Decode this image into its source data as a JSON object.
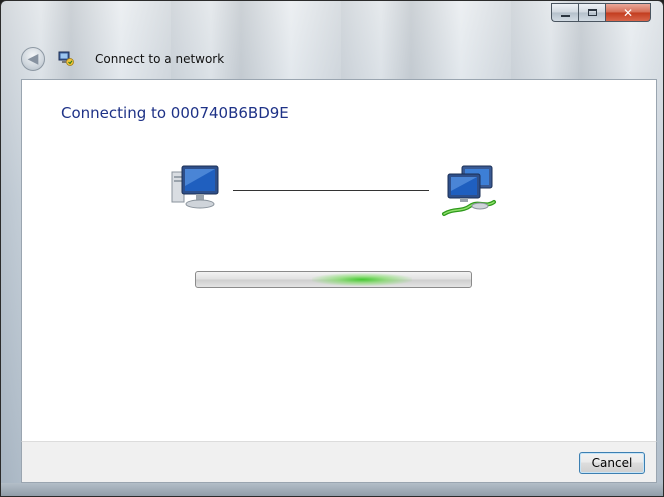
{
  "window": {
    "title": "Connect to a network",
    "caption": {
      "minimize_icon": "minimize-icon",
      "maximize_icon": "maximize-icon",
      "close_glyph": "✕"
    }
  },
  "nav": {
    "back_glyph": "◀",
    "app_icon": "network-wizard-icon"
  },
  "main": {
    "heading": "Connecting to 000740B6BD9E",
    "source_icon": "computer-icon",
    "target_icon": "network-icon",
    "progress": {
      "mode": "indeterminate",
      "glow_position": 0.42
    }
  },
  "footer": {
    "cancel_label": "Cancel"
  },
  "colors": {
    "heading": "#1e3287",
    "progress_glow": "#3cc828",
    "close_button": "#c23c1e",
    "button_focus_border": "#3c7fb1"
  }
}
